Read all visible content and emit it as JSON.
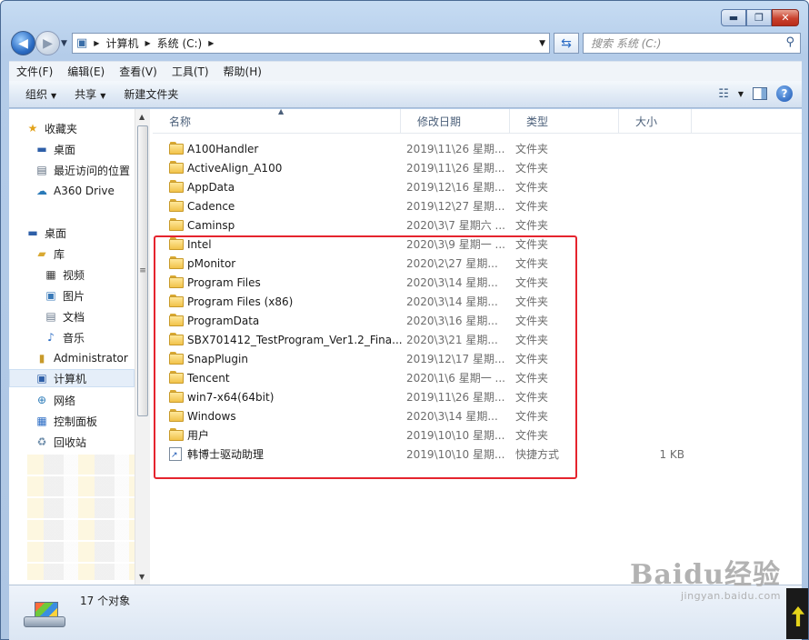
{
  "window": {
    "buttons": {
      "minimize": "▬",
      "maximize": "❐",
      "close": "✕"
    }
  },
  "nav": {
    "back_glyph": "◀",
    "forward_glyph": "▶",
    "breadcrumb": [
      "计算机",
      "系统 (C:)"
    ],
    "search_placeholder": "搜索 系统 (C:)"
  },
  "menu": [
    "文件(F)",
    "编辑(E)",
    "查看(V)",
    "工具(T)",
    "帮助(H)"
  ],
  "toolbar": {
    "organize": "组织",
    "share": "共享",
    "new_folder": "新建文件夹",
    "help": "?"
  },
  "sidebar": {
    "favorites": [
      {
        "label": "收藏夹",
        "icon": "star-icon"
      },
      {
        "label": "桌面",
        "icon": "desktop-icon"
      },
      {
        "label": "最近访问的位置",
        "icon": "recent-places-icon"
      },
      {
        "label": "A360 Drive",
        "icon": "cloud-drive-icon"
      }
    ],
    "tree": [
      {
        "label": "桌面",
        "icon": "desktop-icon"
      },
      {
        "label": "库",
        "icon": "library-icon"
      },
      {
        "label": "视频",
        "icon": "video-icon"
      },
      {
        "label": "图片",
        "icon": "pictures-icon"
      },
      {
        "label": "文档",
        "icon": "documents-icon"
      },
      {
        "label": "音乐",
        "icon": "music-icon"
      },
      {
        "label": "Administrator",
        "icon": "user-folder-icon"
      },
      {
        "label": "计算机",
        "icon": "computer-icon"
      },
      {
        "label": "网络",
        "icon": "network-icon"
      },
      {
        "label": "控制面板",
        "icon": "control-panel-icon"
      },
      {
        "label": "回收站",
        "icon": "recycle-bin-icon"
      }
    ]
  },
  "columns": {
    "name": "名称",
    "date": "修改日期",
    "type": "类型",
    "size": "大小"
  },
  "files": [
    {
      "name": "A100Handler",
      "date": "2019\\11\\26 星期...",
      "type": "文件夹",
      "size": ""
    },
    {
      "name": "ActiveAlign_A100",
      "date": "2019\\11\\26 星期...",
      "type": "文件夹",
      "size": ""
    },
    {
      "name": "AppData",
      "date": "2019\\12\\16 星期...",
      "type": "文件夹",
      "size": ""
    },
    {
      "name": "Cadence",
      "date": "2019\\12\\27 星期...",
      "type": "文件夹",
      "size": ""
    },
    {
      "name": "Caminsp",
      "date": "2020\\3\\7 星期六 ...",
      "type": "文件夹",
      "size": ""
    },
    {
      "name": "Intel",
      "date": "2020\\3\\9 星期一 ...",
      "type": "文件夹",
      "size": ""
    },
    {
      "name": "pMonitor",
      "date": "2020\\2\\27 星期...",
      "type": "文件夹",
      "size": ""
    },
    {
      "name": "Program Files",
      "date": "2020\\3\\14 星期...",
      "type": "文件夹",
      "size": ""
    },
    {
      "name": "Program Files (x86)",
      "date": "2020\\3\\14 星期...",
      "type": "文件夹",
      "size": ""
    },
    {
      "name": "ProgramData",
      "date": "2020\\3\\16 星期...",
      "type": "文件夹",
      "size": ""
    },
    {
      "name": "SBX701412_TestProgram_Ver1.2_Fina...",
      "date": "2020\\3\\21 星期...",
      "type": "文件夹",
      "size": ""
    },
    {
      "name": "SnapPlugin",
      "date": "2019\\12\\17 星期...",
      "type": "文件夹",
      "size": ""
    },
    {
      "name": "Tencent",
      "date": "2020\\1\\6 星期一 ...",
      "type": "文件夹",
      "size": ""
    },
    {
      "name": "win7-x64(64bit)",
      "date": "2019\\11\\26 星期...",
      "type": "文件夹",
      "size": ""
    },
    {
      "name": "Windows",
      "date": "2020\\3\\14 星期...",
      "type": "文件夹",
      "size": ""
    },
    {
      "name": "用户",
      "date": "2019\\10\\10 星期...",
      "type": "文件夹",
      "size": ""
    },
    {
      "name": "韩博士驱动助理",
      "date": "2019\\10\\10 星期...",
      "type": "快捷方式",
      "size": "1 KB"
    }
  ],
  "status": {
    "item_count": "17 个对象"
  },
  "watermark": {
    "brand": "Baidu经验",
    "url": "jingyan.baidu.com"
  },
  "colors": {
    "highlight": "#e5242e",
    "folder": "#f1c24a",
    "accent": "#2b6cc4"
  }
}
